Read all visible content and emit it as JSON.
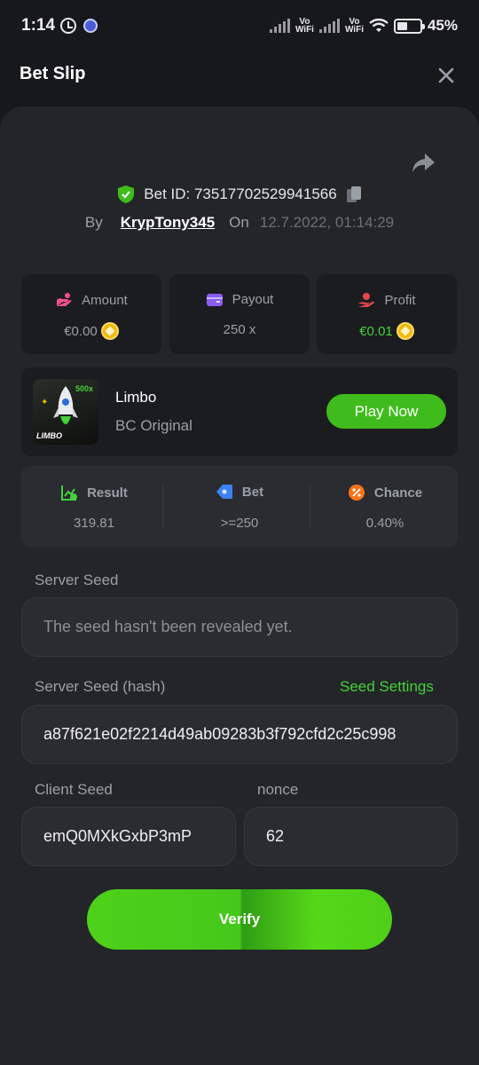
{
  "status_bar": {
    "time": "1:14",
    "battery_percent": "45%",
    "network_label": "Vo WiFi"
  },
  "header": {
    "title": "Bet Slip"
  },
  "bet": {
    "bet_id": "Bet ID: 73517702529941566",
    "by_label": "By",
    "username": "KrypTony345",
    "on_label": "On",
    "date": "12.7.2022, 01:14:29"
  },
  "stats": {
    "amount": {
      "label": "Amount",
      "value": "€0.00"
    },
    "payout": {
      "label": "Payout",
      "value": "250 x"
    },
    "profit": {
      "label": "Profit",
      "value": "€0.01"
    }
  },
  "game": {
    "name": "Limbo",
    "provider": "BC Original",
    "thumb_badge": "500x",
    "thumb_logo": "LIMBO",
    "play_label": "Play Now"
  },
  "result_strip": {
    "result": {
      "label": "Result",
      "value": "319.81"
    },
    "bet": {
      "label": "Bet",
      "value": ">=250"
    },
    "chance": {
      "label": "Chance",
      "value": "0.40%"
    }
  },
  "fairness": {
    "server_seed_label": "Server Seed",
    "server_seed_value": "The seed hasn't been revealed yet.",
    "server_seed_hash_label": "Server Seed (hash)",
    "seed_settings_label": "Seed Settings",
    "server_seed_hash_value": "a87f621e02f2214d49ab09283b3f792cfd2c25c998",
    "client_seed_label": "Client Seed",
    "client_seed_value": "emQ0MXkGxbP3mP",
    "nonce_label": "nonce",
    "nonce_value": "62"
  },
  "verify_label": "Verify",
  "colors": {
    "accent_green": "#45d13a",
    "button_green": "#3fbc1b",
    "panel": "#232529",
    "card": "#1b1c20",
    "coin": "#f0b90b"
  }
}
